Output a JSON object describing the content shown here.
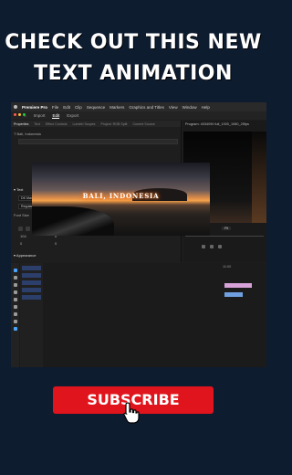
{
  "headline": {
    "line1": "CHECK OUT THIS NEW",
    "line2": "TEXT ANIMATION"
  },
  "menubar": {
    "app_name": "Premiere Pro",
    "items": [
      "File",
      "Edit",
      "Clip",
      "Sequence",
      "Markers",
      "Graphics and Titles",
      "View",
      "Window",
      "Help"
    ]
  },
  "modebar": {
    "tabs": [
      "Import",
      "Edit",
      "Export"
    ],
    "active": "Edit"
  },
  "panel": {
    "tabs": [
      "Properties",
      "Text",
      "Effect Controls",
      "Lumetri Scopes",
      "Project: RGB Split",
      "Current Source"
    ],
    "layer_name": "Bali, Indonesia",
    "section_text": "Text",
    "font": "DK Mandarin Whispers",
    "style": "Regular",
    "font_size_label": "Font Size",
    "metrics": [
      "104",
      "0",
      "0",
      "0"
    ],
    "section_appearance": "Appearance"
  },
  "monitor": {
    "title": "Program: 4034090 full_1920_1080_25fps",
    "timecode": "00;00;01;23",
    "fit": "Fit"
  },
  "timeline": {
    "ruler_mark": "11:00"
  },
  "preview": {
    "caption": "BALI, INDONESIA"
  },
  "cta": {
    "subscribe": "SUBSCRIBE"
  },
  "colors": {
    "background": "#0e1c30",
    "subscribe_red": "#e0141c",
    "caption_glow": "#ff6a00"
  }
}
